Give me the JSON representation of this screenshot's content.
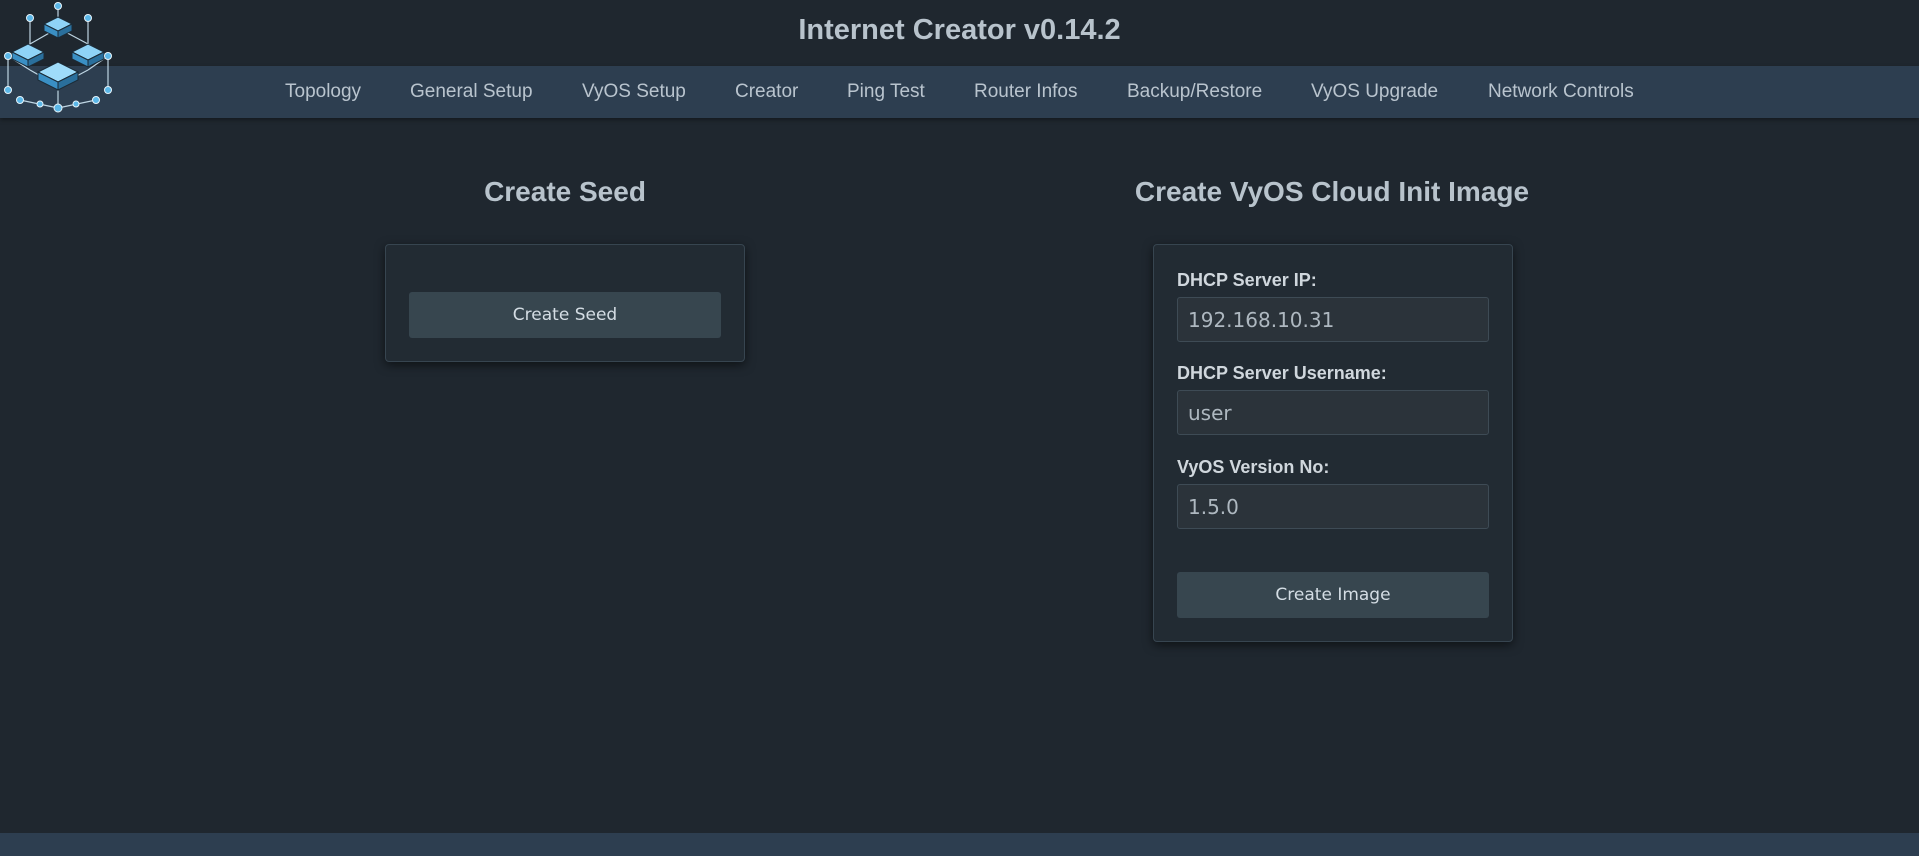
{
  "app": {
    "title": "Internet Creator v0.14.2"
  },
  "nav": {
    "items": [
      {
        "label": "Topology"
      },
      {
        "label": "General Setup"
      },
      {
        "label": "VyOS Setup"
      },
      {
        "label": "Creator"
      },
      {
        "label": "Ping Test"
      },
      {
        "label": "Router Infos"
      },
      {
        "label": "Backup/Restore"
      },
      {
        "label": "VyOS Upgrade"
      },
      {
        "label": "Network Controls"
      }
    ]
  },
  "seed_section": {
    "heading": "Create Seed",
    "button_label": "Create Seed"
  },
  "image_section": {
    "heading": "Create VyOS Cloud Init Image",
    "fields": [
      {
        "label": "DHCP Server IP:",
        "value": "192.168.10.31"
      },
      {
        "label": "DHCP Server Username:",
        "value": "user"
      },
      {
        "label": "VyOS Version No:",
        "value": "1.5.0"
      }
    ],
    "button_label": "Create Image"
  },
  "icons": {
    "logo": "network-servers-logo-icon"
  },
  "colors": {
    "background": "#1f272f",
    "navbar": "#2d3e50",
    "card": "#222b33",
    "button": "#37464f",
    "logo_accent": "#5bb7e8"
  }
}
